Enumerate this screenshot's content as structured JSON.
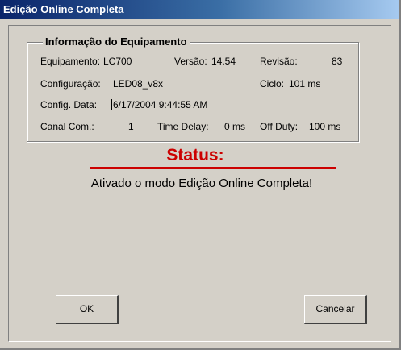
{
  "window": {
    "title": "Edição Online Completa"
  },
  "equipment_info": {
    "group_title": "Informação do Equipamento",
    "equipamento_label": "Equipamento:",
    "equipamento_value": "LC700",
    "versao_label": "Versão:",
    "versao_value": "14.54",
    "revisao_label": "Revisão:",
    "revisao_value": "83",
    "configuracao_label": "Configuração:",
    "configuracao_value": "LED08_v8x",
    "ciclo_label": "Ciclo:",
    "ciclo_value": "101 ms",
    "config_data_label": "Config. Data:",
    "config_data_value": "6/17/2004 9:44:55 AM",
    "canal_label": "Canal Com.:",
    "canal_value": "1",
    "time_delay_label": "Time Delay:",
    "time_delay_value": "0 ms",
    "off_duty_label": "Off Duty:",
    "off_duty_value": "100 ms"
  },
  "status": {
    "title": "Status:",
    "message": "Ativado o modo Edição Online Completa!",
    "color": "#cc0000"
  },
  "buttons": {
    "ok_label": "OK",
    "cancel_label": "Cancelar"
  }
}
